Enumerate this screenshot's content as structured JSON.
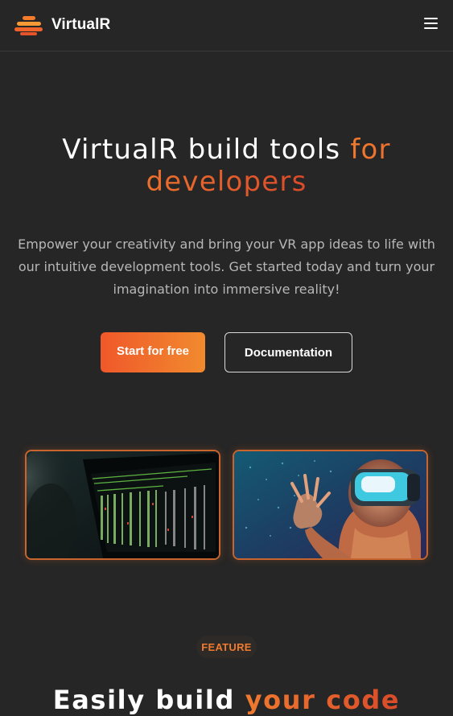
{
  "brand": {
    "name": "VirtualR",
    "logo_icon": "layered-stack-logo"
  },
  "nav": {
    "menu_icon": "hamburger-menu-icon"
  },
  "hero": {
    "title_part1": "VirtualR build tools ",
    "title_accent": "for developers",
    "subtitle": "Empower your creativity and bring your VR app ideas to life with our intuitive development tools. Get started today and turn your imagination into immersive reality!",
    "primary_button": "Start for free",
    "secondary_button": "Documentation"
  },
  "media": {
    "left_image": "code-terminal-image",
    "right_image": "vr-headset-image"
  },
  "feature": {
    "badge": "FEATURE",
    "title_part1": "Easily build ",
    "title_accent": "your code"
  },
  "colors": {
    "background": "#262626",
    "accent_start": "#f0582a",
    "accent_end": "#f18a2e",
    "muted_text": "#b7b7b7"
  }
}
